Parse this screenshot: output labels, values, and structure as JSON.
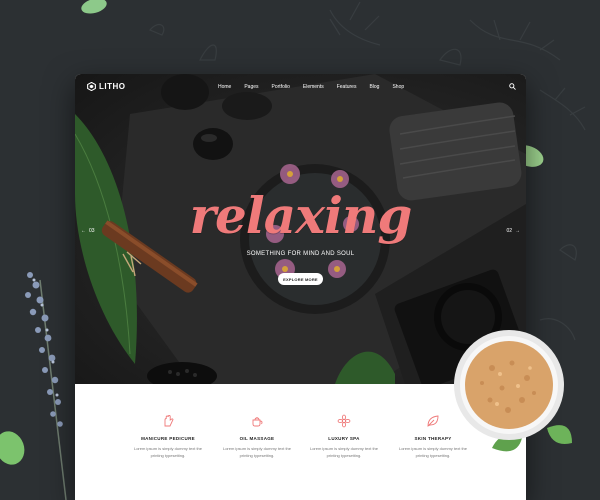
{
  "brand": {
    "name": "LITHO"
  },
  "nav": {
    "items": [
      "Home",
      "Pages",
      "Portfolio",
      "Elements",
      "Features",
      "Blog",
      "Shop"
    ],
    "search_icon": "search-icon"
  },
  "hero": {
    "headline": "relaxing",
    "tagline": "SOMETHING FOR MIND AND SOUL",
    "cta_label": "EXPLORE MORE",
    "prev_label": "03",
    "next_label": "02",
    "headline_color": "#ef7a7a"
  },
  "features": [
    {
      "icon": "hand-icon",
      "title": "MANICURE PEDICURE",
      "desc": "Lorem ipsum is simply dummy text the printing typesetting."
    },
    {
      "icon": "teapot-icon",
      "title": "OIL MASSAGE",
      "desc": "Lorem ipsum is simply dummy text the printing typesetting."
    },
    {
      "icon": "flower-icon",
      "title": "LUXURY SPA",
      "desc": "Lorem ipsum is simply dummy text the printing typesetting."
    },
    {
      "icon": "leaf-icon",
      "title": "SKIN THERAPY",
      "desc": "Lorem ipsum is simply dummy text the printing typesetting."
    }
  ],
  "colors": {
    "accent": "#ef7a7a",
    "background": "#2c3033"
  }
}
